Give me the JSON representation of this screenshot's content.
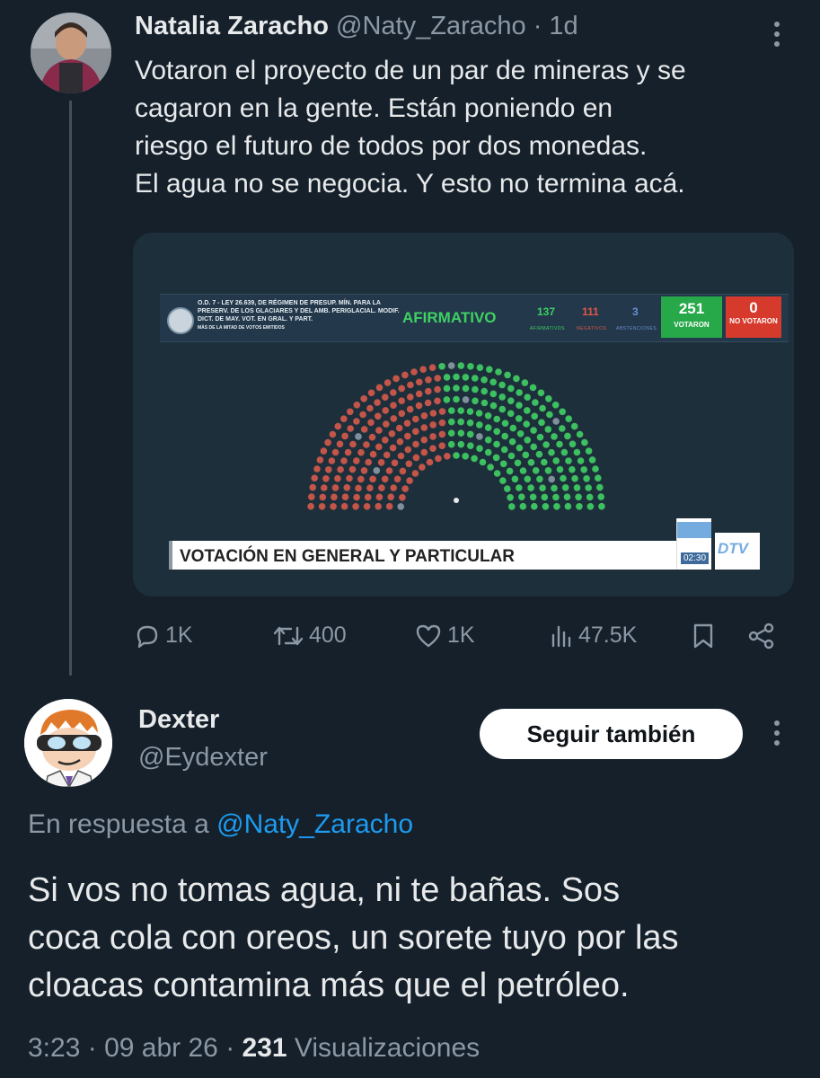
{
  "parent_tweet": {
    "author_name": "Natalia Zaracho",
    "author_handle": "@Naty_Zaracho",
    "time": "1d",
    "text_lines": [
      "Votaron el proyecto de un par de mineras y se",
      "cagaron en la gente. Están poniendo en",
      "riesgo el futuro de todos por dos monedas.",
      "El agua no se negocia. Y esto no termina acá."
    ],
    "media": {
      "bill_title": "O.D. 7 - LEY 26.639, DE RÉGIMEN DE PRESUP. MÍN. PARA LA PRESERV. DE LOS GLACIARES Y DEL AMB. PERIGLACIAL. MODIF. DICT. DE MAY. VOT. EN GRAL. Y PART.",
      "majority_note": "MÁS DE LA MITAD DE VOTOS EMITIDOS",
      "result": "AFIRMATIVO",
      "afirmativos": "137",
      "afirmativos_label": "AFIRMATIVOS",
      "negativos": "111",
      "negativos_label": "NEGATIVOS",
      "abstenciones": "3",
      "abstenciones_label": "ABSTENCIONES",
      "votaron": "251",
      "votaron_label": "VOTARON",
      "no_votaron": "0",
      "no_votaron_label": "NO VOTARON",
      "banner": "VOTACIÓN EN GENERAL Y PARTICULAR",
      "clock": "02:30",
      "channel_logo": "DTV",
      "colors": {
        "afirmativo": "#3fd064",
        "negativo": "#d65a4a",
        "abstencion": "#6a8fd6"
      }
    },
    "stats": {
      "replies": "1K",
      "reposts": "400",
      "likes": "1K",
      "views": "47.5K"
    }
  },
  "reply_tweet": {
    "author_name": "Dexter",
    "author_handle": "@Eydexter",
    "follow_label": "Seguir también",
    "reply_prefix": "En respuesta a",
    "reply_handle": "@Naty_Zaracho",
    "text_lines": [
      "Si vos no tomas agua, ni te bañas. Sos",
      "coca cola con oreos, un sorete tuyo por las",
      "cloacas contamina más que el petróleo."
    ],
    "time": "3:23",
    "date": "09 abr 26",
    "views_count": "231",
    "views_label": "Visualizaciones"
  }
}
